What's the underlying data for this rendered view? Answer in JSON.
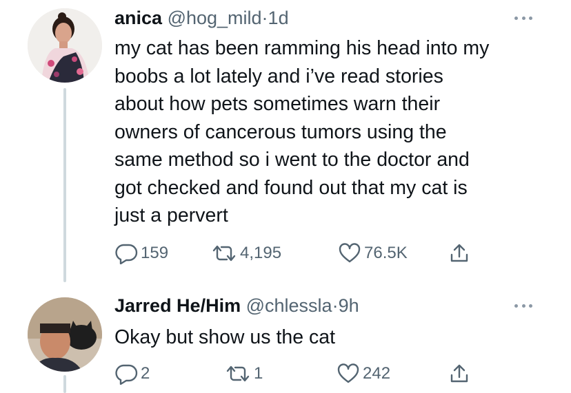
{
  "tweets": [
    {
      "name": "anica",
      "handle": "@hog_mild",
      "separator": "·",
      "time": "1d",
      "lines": [
        "my cat has been ramming his head into my",
        "boobs a lot lately and i’ve read stories",
        "about how pets sometimes warn their",
        "owners of cancerous tumors using the",
        "same method so i went to the doctor and",
        "got checked and found out that my cat is",
        "just a pervert"
      ],
      "replies": "159",
      "retweets": "4,195",
      "likes": "76.5K"
    },
    {
      "name": "Jarred He/Him",
      "handle": "@chlessla",
      "separator": "·",
      "time": "9h",
      "lines": [
        "Okay but show us the cat"
      ],
      "replies": "2",
      "retweets": "1",
      "likes": "242"
    }
  ],
  "icons": {
    "reply": "reply-icon",
    "retweet": "retweet-icon",
    "like": "heart-icon",
    "share": "share-icon",
    "more": "more-icon"
  },
  "colors": {
    "text": "#0f1419",
    "secondary": "#536471",
    "thread_line": "#cfd9de"
  }
}
